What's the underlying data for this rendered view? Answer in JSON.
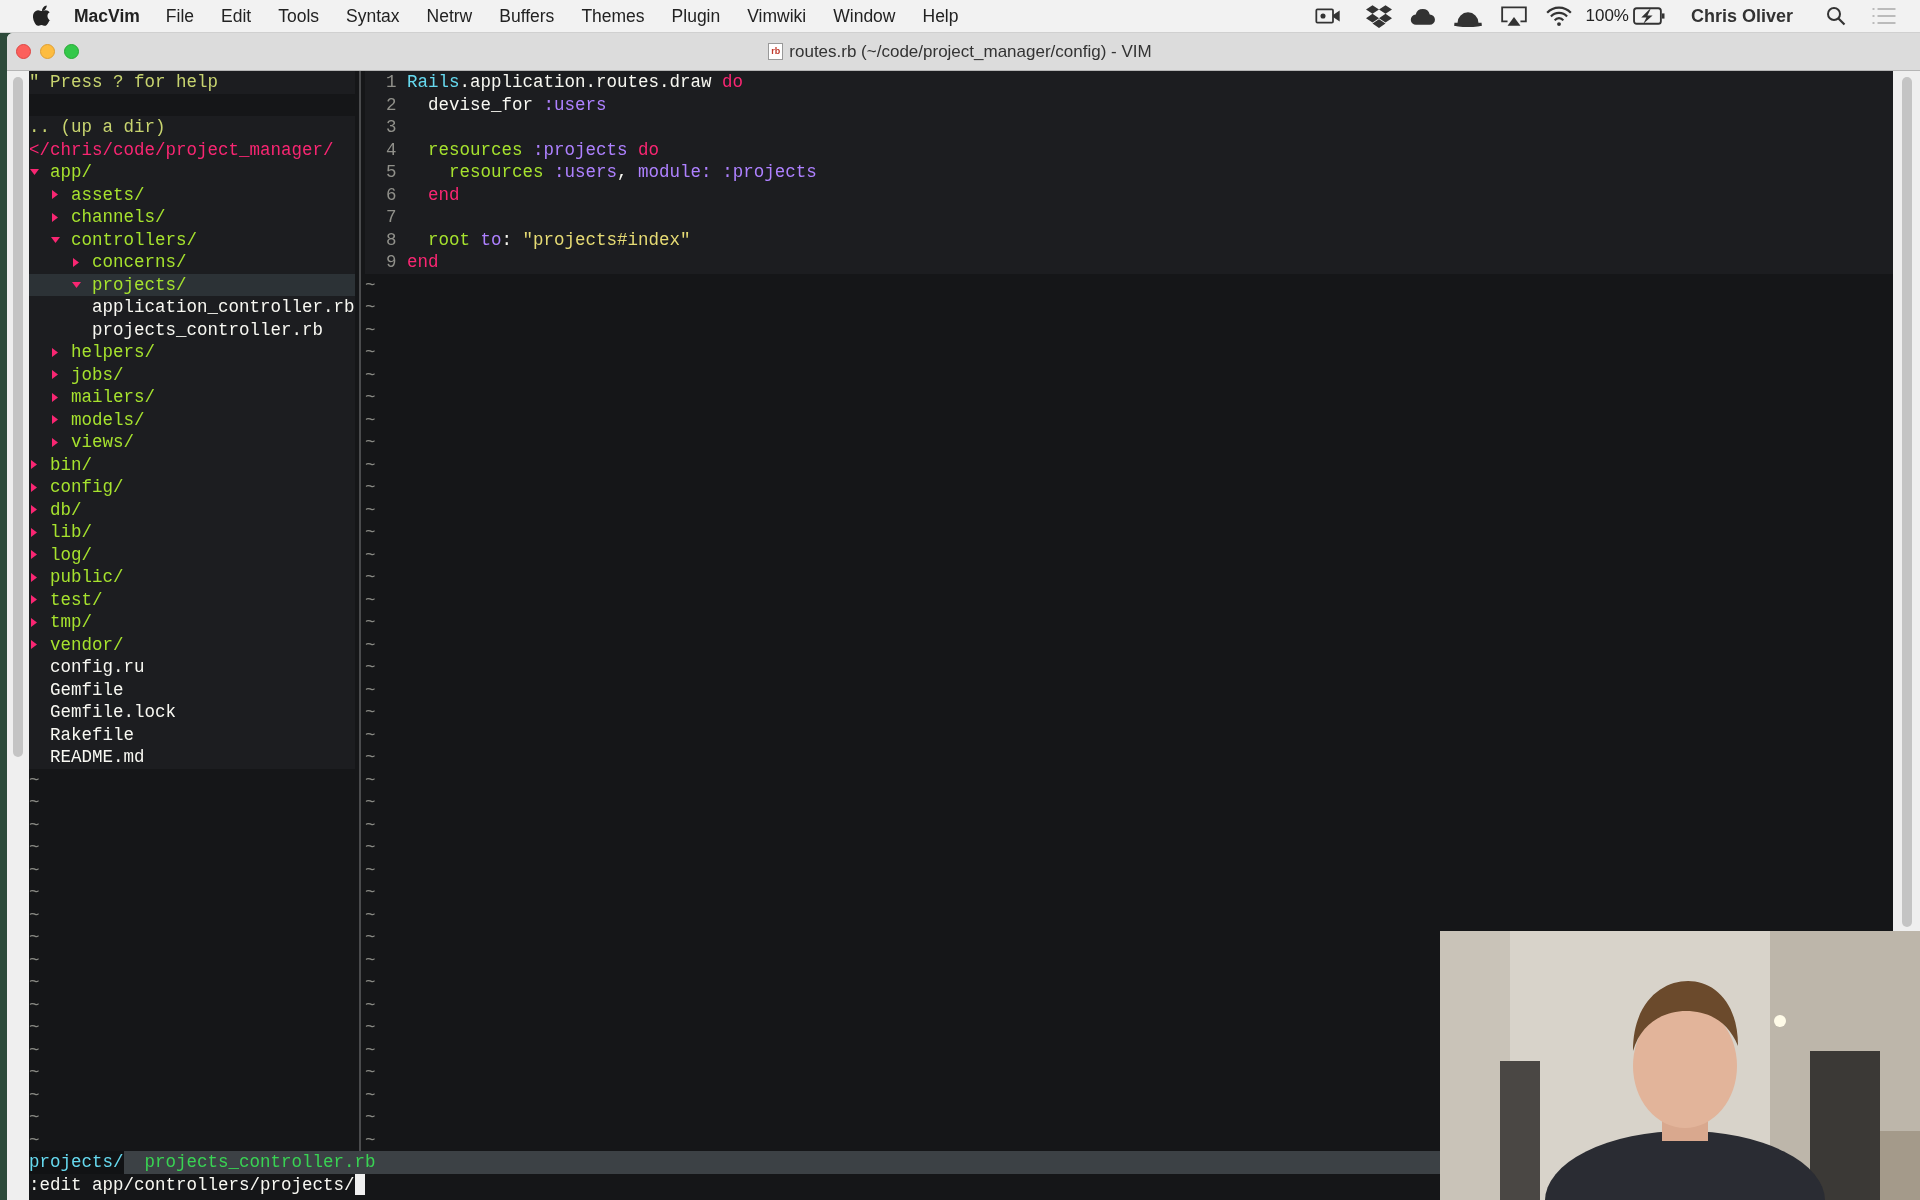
{
  "menu_bar": {
    "app_name": "MacVim",
    "menus": [
      "File",
      "Edit",
      "Tools",
      "Syntax",
      "Netrw",
      "Buffers",
      "Themes",
      "Plugin",
      "Vimwiki",
      "Window",
      "Help"
    ],
    "battery": "100%",
    "user": "Chris Oliver"
  },
  "window": {
    "title": "routes.rb (~/code/project_manager/config) - VIM",
    "file_icon_text": "rb"
  },
  "file_explorer": {
    "help": "\" Press ? for help",
    "up_dir": ".. (up a dir)",
    "root": "</chris/code/project_manager/",
    "tree": [
      {
        "name": "app/",
        "kind": "dir",
        "expanded": true,
        "selected": false,
        "children": [
          {
            "name": "assets/",
            "kind": "dir",
            "expanded": false,
            "selected": false
          },
          {
            "name": "channels/",
            "kind": "dir",
            "expanded": false,
            "selected": false
          },
          {
            "name": "controllers/",
            "kind": "dir",
            "expanded": true,
            "selected": false,
            "children": [
              {
                "name": "concerns/",
                "kind": "dir",
                "expanded": false,
                "selected": false
              },
              {
                "name": "projects/",
                "kind": "dir",
                "expanded": true,
                "selected": true
              },
              {
                "name": "application_controller.rb",
                "kind": "file",
                "selected": false
              },
              {
                "name": "projects_controller.rb",
                "kind": "file",
                "selected": false
              }
            ]
          },
          {
            "name": "helpers/",
            "kind": "dir",
            "expanded": false,
            "selected": false
          },
          {
            "name": "jobs/",
            "kind": "dir",
            "expanded": false,
            "selected": false
          },
          {
            "name": "mailers/",
            "kind": "dir",
            "expanded": false,
            "selected": false
          },
          {
            "name": "models/",
            "kind": "dir",
            "expanded": false,
            "selected": false
          },
          {
            "name": "views/",
            "kind": "dir",
            "expanded": false,
            "selected": false
          }
        ]
      },
      {
        "name": "bin/",
        "kind": "dir",
        "expanded": false,
        "selected": false
      },
      {
        "name": "config/",
        "kind": "dir",
        "expanded": false,
        "selected": false
      },
      {
        "name": "db/",
        "kind": "dir",
        "expanded": false,
        "selected": false
      },
      {
        "name": "lib/",
        "kind": "dir",
        "expanded": false,
        "selected": false
      },
      {
        "name": "log/",
        "kind": "dir",
        "expanded": false,
        "selected": false
      },
      {
        "name": "public/",
        "kind": "dir",
        "expanded": false,
        "selected": false
      },
      {
        "name": "test/",
        "kind": "dir",
        "expanded": false,
        "selected": false
      },
      {
        "name": "tmp/",
        "kind": "dir",
        "expanded": false,
        "selected": false
      },
      {
        "name": "vendor/",
        "kind": "dir",
        "expanded": false,
        "selected": false
      },
      {
        "name": "config.ru",
        "kind": "file",
        "selected": false
      },
      {
        "name": "Gemfile",
        "kind": "file",
        "selected": false
      },
      {
        "name": "Gemfile.lock",
        "kind": "file",
        "selected": false
      },
      {
        "name": "Rakefile",
        "kind": "file",
        "selected": false
      },
      {
        "name": "README.md",
        "kind": "file",
        "selected": false
      }
    ],
    "filler": [
      "~",
      "~",
      "~",
      "~",
      "~",
      "~",
      "~",
      "~",
      "~",
      "~",
      "~",
      "~",
      "~",
      "~",
      "~",
      "~",
      "~"
    ]
  },
  "editor": {
    "lines": [
      {
        "number": "1",
        "tokens": [
          {
            "text": "Rails",
            "kind": "constant"
          },
          {
            "text": ".application.routes.draw ",
            "kind": "plain"
          },
          {
            "text": "do",
            "kind": "keyword"
          }
        ]
      },
      {
        "number": "2",
        "tokens": [
          {
            "text": "  devise_for ",
            "kind": "plain"
          },
          {
            "text": ":users",
            "kind": "symbol"
          }
        ]
      },
      {
        "number": "3"
      },
      {
        "number": "4",
        "tokens": [
          {
            "text": "  resources ",
            "kind": "method"
          },
          {
            "text": ":projects ",
            "kind": "symbol"
          },
          {
            "text": "do",
            "kind": "keyword"
          }
        ]
      },
      {
        "number": "5",
        "tokens": [
          {
            "text": "    resources ",
            "kind": "method"
          },
          {
            "text": ":users",
            "kind": "symbol"
          },
          {
            "text": ", ",
            "kind": "plain"
          },
          {
            "text": "module:",
            "kind": "symbol"
          },
          {
            "text": " :projects",
            "kind": "symbol"
          }
        ]
      },
      {
        "number": "6",
        "tokens": [
          {
            "text": "  end",
            "kind": "keyword"
          }
        ]
      },
      {
        "number": "7"
      },
      {
        "number": "8",
        "tokens": [
          {
            "text": "  root ",
            "kind": "method"
          },
          {
            "text": "to",
            "kind": "symbol"
          },
          {
            "text": ": ",
            "kind": "plain"
          },
          {
            "text": "\"projects#index\"",
            "kind": "string"
          }
        ]
      },
      {
        "number": "9",
        "tokens": [
          {
            "text": "end",
            "kind": "keyword"
          }
        ]
      }
    ],
    "filler": [
      "~",
      "~",
      "~",
      "~",
      "~",
      "~",
      "~",
      "~",
      "~",
      "~",
      "~",
      "~",
      "~",
      "~",
      "~",
      "~",
      "~",
      "~",
      "~",
      "~",
      "~",
      "~",
      "~",
      "~",
      "~",
      "~",
      "~",
      "~",
      "~",
      "~",
      "~",
      "~",
      "~",
      "~",
      "~",
      "~",
      "~",
      "~",
      "~"
    ]
  },
  "wildmenu": [
    {
      "text": "projects/",
      "selected": true
    },
    {
      "text": "  projects_controller.rb",
      "selected": false
    }
  ],
  "command_line": {
    "text": ":edit app/controllers/projects/"
  }
}
